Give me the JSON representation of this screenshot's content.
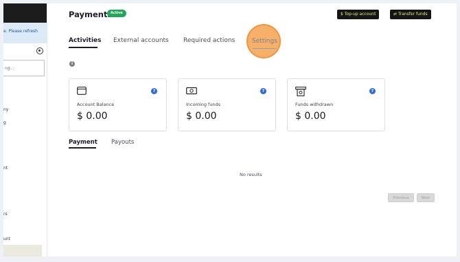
{
  "sidebar": {
    "banner": "e. Please refresh",
    "search_placeholder": "ng...",
    "items": [
      "ny",
      "g",
      "nt",
      "rs",
      "unt"
    ]
  },
  "header": {
    "title": "Payments",
    "status_badge": "Active",
    "topup_label": "Top-up account",
    "transfer_label": "Transfer funds"
  },
  "tabs": [
    {
      "label": "Activities",
      "active": true
    },
    {
      "label": "External accounts",
      "active": false
    },
    {
      "label": "Required actions",
      "active": false
    },
    {
      "label": "Settings",
      "active": false
    }
  ],
  "cards": [
    {
      "label": "Account Balance",
      "value": "$ 0.00",
      "icon": "wallet-icon"
    },
    {
      "label": "Incoming funds",
      "value": "$ 0.00",
      "icon": "cash-icon"
    },
    {
      "label": "Funds withdrawn",
      "value": "$ 0.00",
      "icon": "withdraw-icon"
    }
  ],
  "subtabs": [
    {
      "label": "Payment",
      "active": true
    },
    {
      "label": "Payouts",
      "active": false
    }
  ],
  "table": {
    "empty_text": "No results"
  },
  "pagination": {
    "previous": "Previous",
    "next": "Next"
  },
  "colors": {
    "accent_badge": "#23a55a",
    "help_icon": "#2f6bdb",
    "highlight": "#f6b06a",
    "button_dark": "#151515"
  }
}
